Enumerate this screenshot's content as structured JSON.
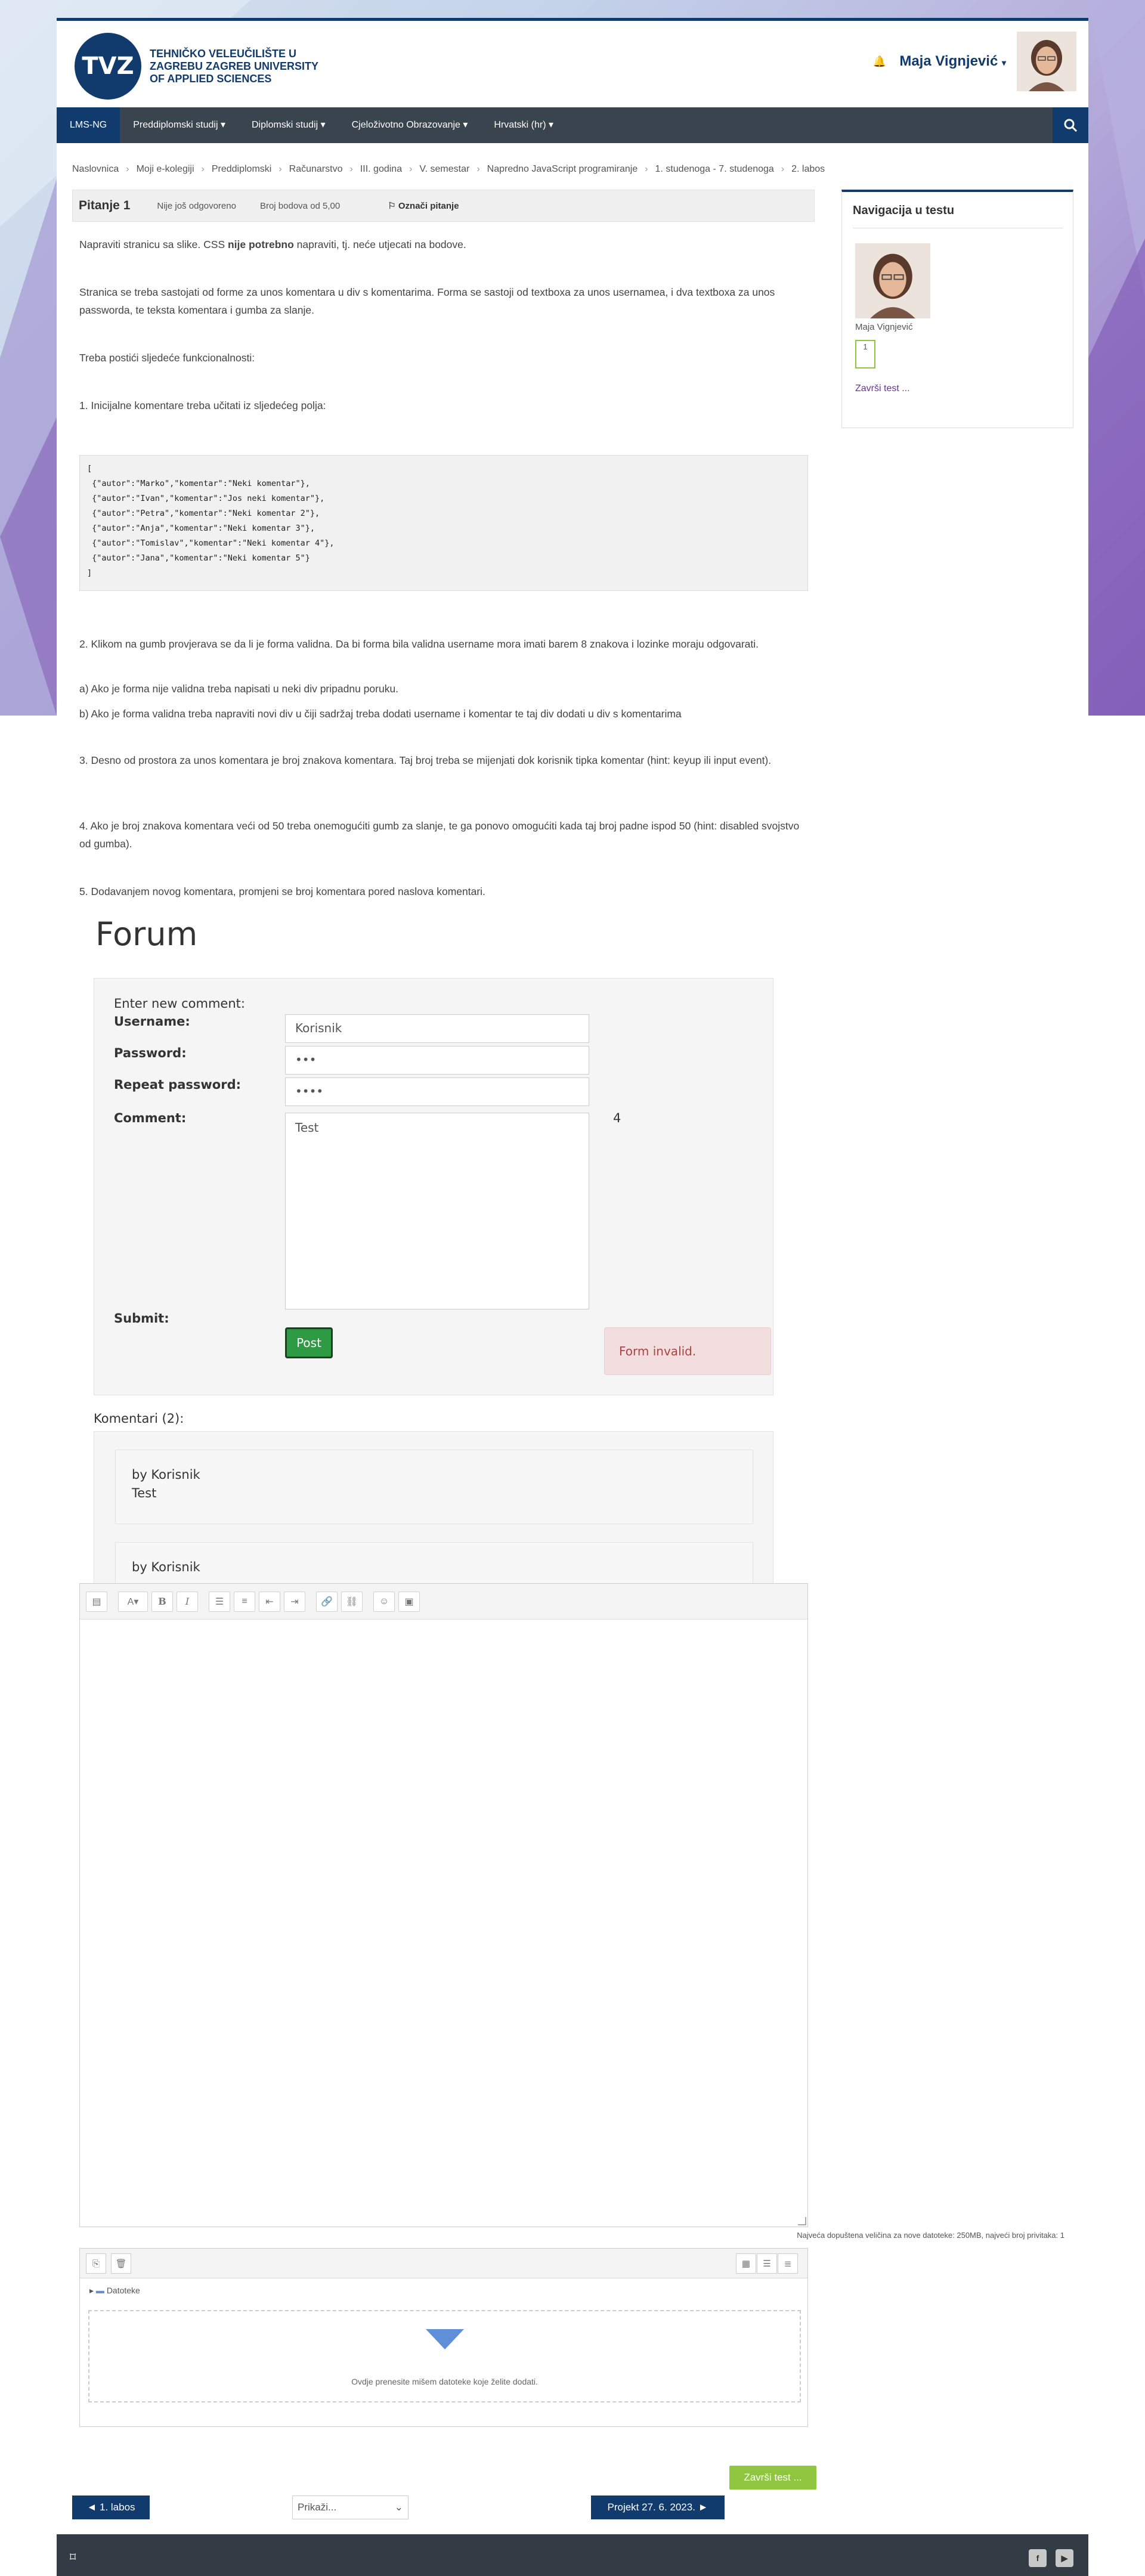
{
  "header": {
    "logo_abbr": "TVZ",
    "logo_line1": "TEHNIČKO VELEUČILIŠTE U",
    "logo_line2": "ZAGREBU ZAGREB UNIVERSITY",
    "logo_line3": "OF APPLIED SCIENCES",
    "user_name": "Maja Vignjević"
  },
  "nav": {
    "items": [
      "LMS-NG",
      "Preddiplomski studij ▾",
      "Diplomski studij ▾",
      "Cjeloživotno Obrazovanje ▾",
      "Hrvatski (hr) ▾"
    ]
  },
  "breadcrumb": [
    "Naslovnica",
    "Moji e-kolegiji",
    "Preddiplomski",
    "Računarstvo",
    "III. godina",
    "V. semestar",
    "Napredno JavaScript programiranje",
    "1. studenoga - 7. studenoga",
    "2. labos"
  ],
  "question": {
    "title": "Pitanje 1",
    "status": "Nije još odgovoreno",
    "points": "Broj bodova od 5,00",
    "flag_label": "Označi pitanje",
    "p1a": "Napraviti stranicu sa slike. CSS ",
    "p1b": "nije potrebno",
    "p1c": " napraviti, tj. neće utjecati na bodove.",
    "p2": "Stranica se treba sastojati od forme za unos komentara u div s komentarima. Forma se sastoji od textboxa za unos usernamea, i dva textboxa za unos passworda, te teksta komentara i gumba za slanje.",
    "p3": "Treba postići sljedeće funkcionalnosti:",
    "p4": "1. Inicijalne komentare treba učitati iz sljedećeg polja:",
    "code": "[\n {\"autor\":\"Marko\",\"komentar\":\"Neki komentar\"},\n {\"autor\":\"Ivan\",\"komentar\":\"Jos neki komentar\"},\n {\"autor\":\"Petra\",\"komentar\":\"Neki komentar 2\"},\n {\"autor\":\"Anja\",\"komentar\":\"Neki komentar 3\"},\n {\"autor\":\"Tomislav\",\"komentar\":\"Neki komentar 4\"},\n {\"autor\":\"Jana\",\"komentar\":\"Neki komentar 5\"}\n]",
    "p5": "2. Klikom na gumb provjerava se da li je forma validna. Da bi forma bila validna username mora imati barem 8 znakova i lozinke moraju odgovarati.",
    "p6": "a) Ako je forma nije validna treba napisati u neki div pripadnu poruku.",
    "p7": "b) Ako je forma validna treba napraviti novi div u čiji sadržaj treba dodati username i komentar te taj div dodati u div s komentarima",
    "p8": "3. Desno od prostora za unos komentara je broj znakova komentara. Taj broj treba se mijenjati dok korisnik tipka komentar (hint: keyup ili input event).",
    "p9": "4. Ako je broj znakova komentara veći od 50 treba onemogućiti gumb za slanje, te ga ponovo omogućiti kada taj broj padne ispod 50 (hint: disabled svojstvo od gumba).",
    "p10": "5. Dodavanjem novog komentara, promjeni se broj komentara pored naslova komentari."
  },
  "forum": {
    "title": "Forum",
    "enter_new": "Enter new comment:",
    "username_label": "Username:",
    "username_value": "Korisnik",
    "password_label": "Password:",
    "password_value": "•••",
    "repeat_label": "Repeat password:",
    "repeat_value": "••••",
    "comment_label": "Comment:",
    "comment_value": "Test",
    "char_count": "4",
    "submit_label": "Submit:",
    "post_button": "Post",
    "invalid_msg": "Form invalid.",
    "komentari": "Komentari (2):",
    "comments": [
      {
        "by": "by Korisnik",
        "text": "Test"
      },
      {
        "by": "by Korisnik",
        "text": ""
      }
    ]
  },
  "editor": {
    "max_size": "Najveća dopuštena veličina za nove datoteke: 250MB, najveći broj privitaka: 1",
    "files_label": "Datoteke",
    "drop_text": "Ovdje prenesite mišem datoteke koje želite dodati."
  },
  "footer_nav": {
    "finish": "Završi test ...",
    "prev": "◄ 1. labos",
    "jump": "Prikaži...",
    "next": "Projekt 27. 6. 2023. ►"
  },
  "sidebar": {
    "title": "Navigacija u testu",
    "name": "Maja Vignjević",
    "qnum": "1",
    "finish_link": "Završi test ..."
  },
  "colors": {
    "brand": "#123b6d",
    "navbar": "#3a444e",
    "finish_green": "#8ec63f",
    "post_green": "#2e9a43"
  }
}
